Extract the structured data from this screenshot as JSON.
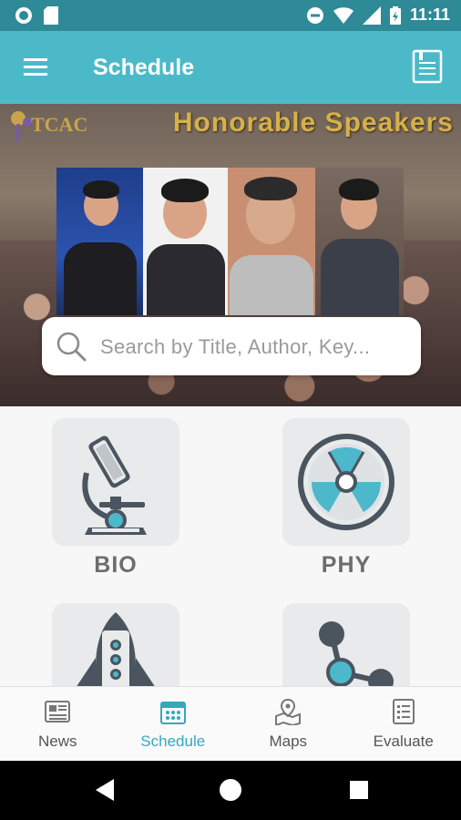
{
  "status_bar": {
    "time": "11:11"
  },
  "app_bar": {
    "title": "Schedule"
  },
  "banner": {
    "title": "Honorable Speakers",
    "logo_text": "TCAC",
    "search_placeholder": "Search by Title, Author, Key..."
  },
  "carousel": {
    "active_index": 0,
    "count": 5
  },
  "categories": [
    {
      "label": "BIO"
    },
    {
      "label": "PHY"
    },
    {
      "label": ""
    },
    {
      "label": ""
    }
  ],
  "bottom_nav": {
    "items": [
      {
        "label": "News",
        "icon": "newspaper-icon"
      },
      {
        "label": "Schedule",
        "icon": "calendar-icon",
        "active": true
      },
      {
        "label": "Maps",
        "icon": "map-pin-icon"
      },
      {
        "label": "Evaluate",
        "icon": "checklist-icon"
      }
    ]
  },
  "colors": {
    "status_bar": "#2f8a98",
    "app_bar": "#4cb9c8",
    "accent": "#34a9bd",
    "icon_dark": "#4a5560",
    "icon_teal": "#4db8cb"
  }
}
